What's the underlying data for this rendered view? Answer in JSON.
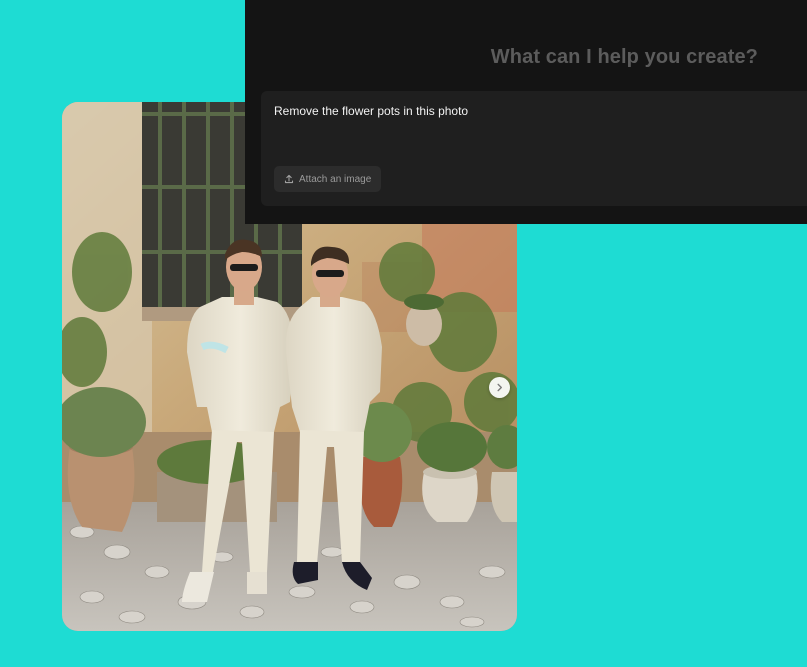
{
  "panel": {
    "title": "What can I help you create?",
    "prompt_text": "Remove the flower pots in this photo",
    "attach_label": "Attach an image"
  },
  "photo": {
    "subject": "photo-of-two-men-in-cream-suits"
  },
  "colors": {
    "background": "#1edcd3",
    "panel": "#141414",
    "prompt_box": "#1f1f1f",
    "title_text": "#5c5c5c"
  },
  "icons": {
    "attach": "upload-icon",
    "carousel": "chevron-right-icon"
  }
}
